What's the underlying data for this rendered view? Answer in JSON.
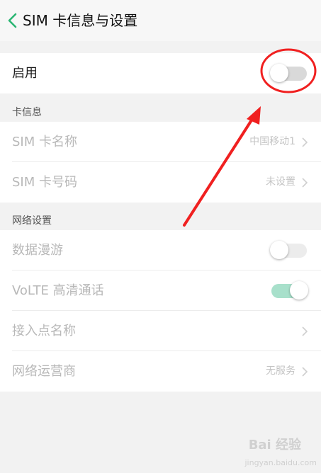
{
  "header": {
    "title": "SIM 卡信息与设置"
  },
  "enable_row": {
    "label": "启用",
    "toggle_state": "off"
  },
  "sections": {
    "card_info": "卡信息",
    "network": "网络设置"
  },
  "card_info_items": [
    {
      "label": "SIM 卡名称",
      "value": "中国移动1"
    },
    {
      "label": "SIM 卡号码",
      "value": "未设置"
    }
  ],
  "network_items": [
    {
      "label": "数据漫游",
      "toggle_state": "off"
    },
    {
      "label": "VoLTE 高清通话",
      "toggle_state": "on"
    },
    {
      "label": "接入点名称",
      "value": ""
    },
    {
      "label": "网络运营商",
      "value": "无服务"
    }
  ],
  "watermark": {
    "text": "Bai 经验",
    "sub": "jingyan.baidu.com"
  },
  "colors": {
    "accent": "#2bb673",
    "annotation_red": "#f02020"
  }
}
